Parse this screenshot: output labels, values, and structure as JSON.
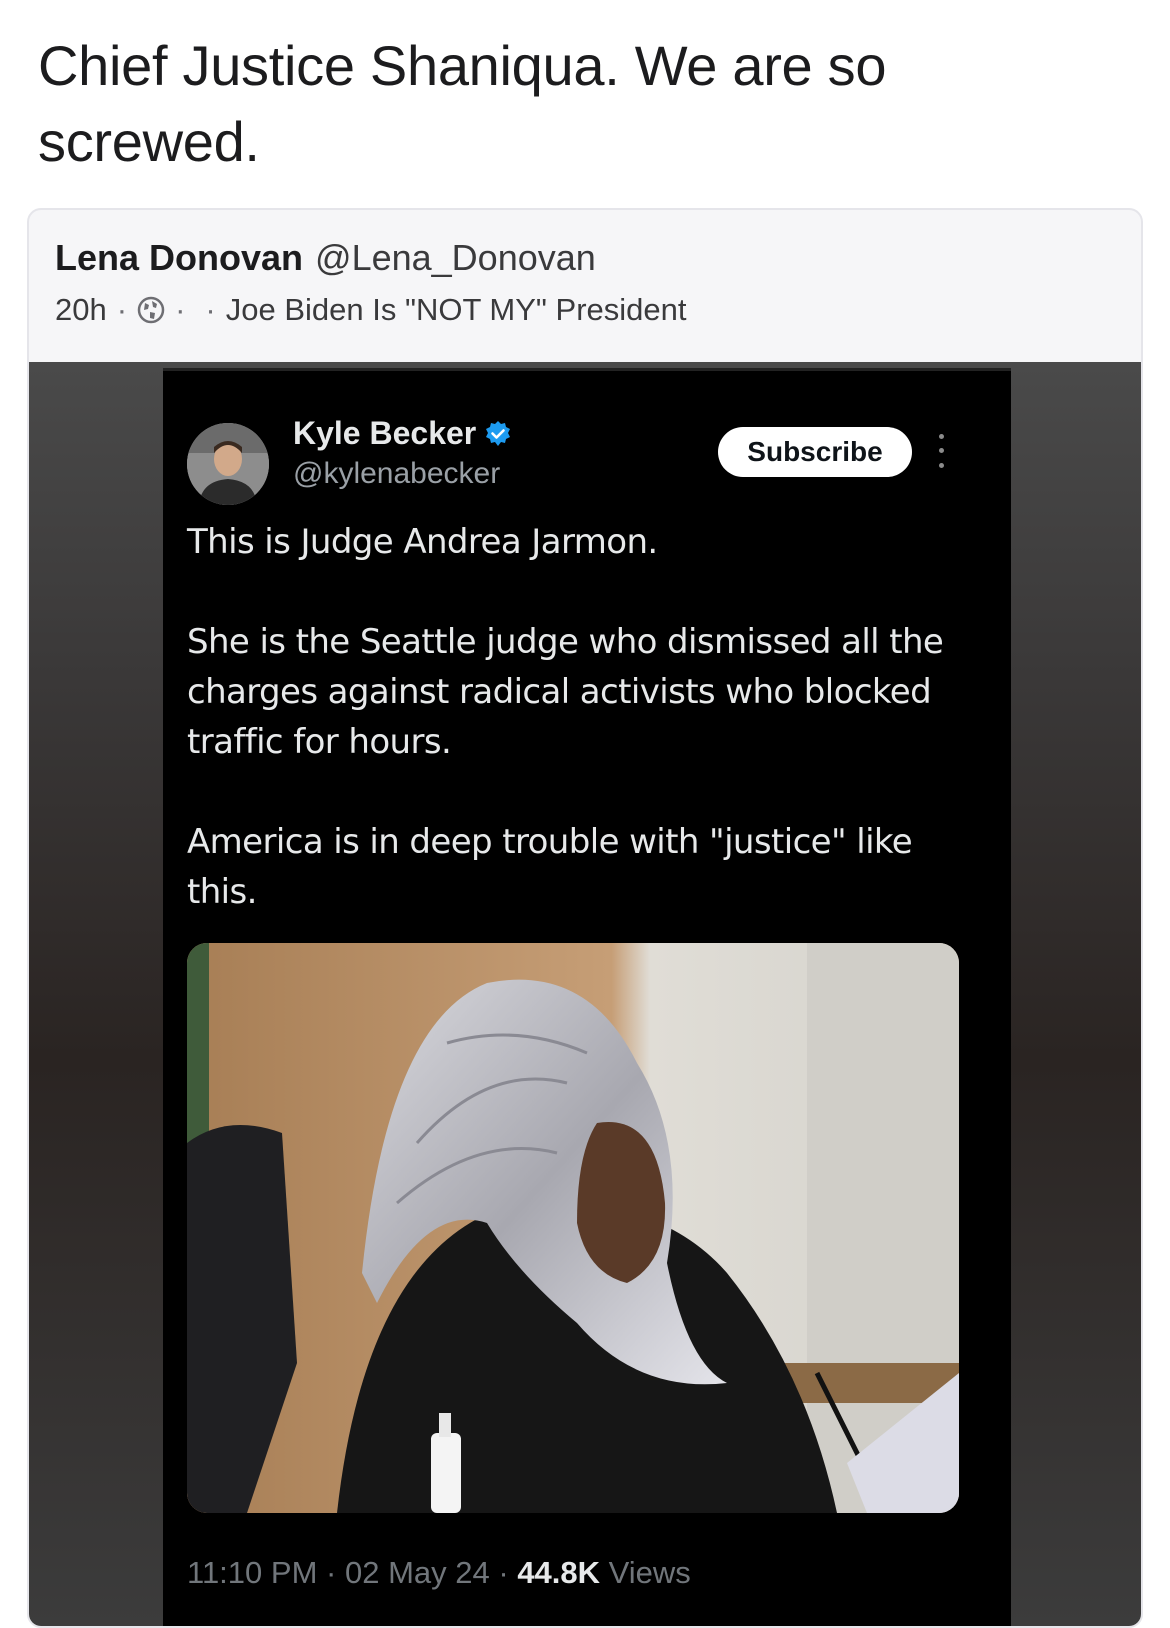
{
  "post": {
    "text": "Chief Justice Shaniqua. We are so screwed."
  },
  "quoted_post": {
    "author_name": "Lena Donovan",
    "author_handle": "@Lena_Donovan",
    "time": "20h",
    "sep1": "·",
    "sep2": "·",
    "sep3": "·",
    "visibility_icon": "globe-icon",
    "group": "Joe Biden Is \"NOT MY\" President"
  },
  "embedded_tweet": {
    "author_name": "Kyle Becker",
    "verified_icon": "verified-badge-icon",
    "author_handle": "@kylenabecker",
    "subscribe_label": "Subscribe",
    "body": [
      "This is Judge Andrea Jarmon.",
      "She is the Seattle judge who dismissed all the charges against radical activists who blocked traffic for hours.",
      "America is in deep trouble with \"justice\" like this."
    ],
    "time": "11:10 PM",
    "dot1": "·",
    "date": "02 May 24",
    "dot2": "·",
    "views_count": "44.8K",
    "views_label": "Views"
  },
  "colors": {
    "verified": "#1d9bf0",
    "tweet_bg": "#000000",
    "card_bg": "#f6f6f8"
  }
}
